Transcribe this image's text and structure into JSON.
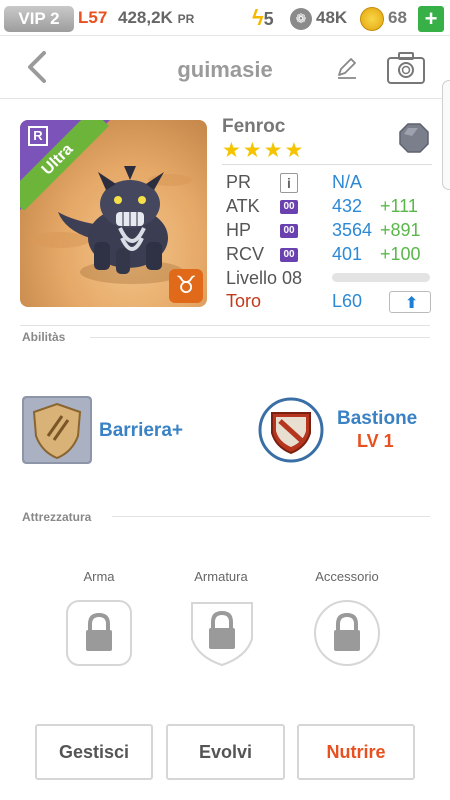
{
  "status_bar": {
    "vip": "VIP 2",
    "level": "L57",
    "pr_value": "428,2K",
    "pr_unit": "PR",
    "energy": "5",
    "paw": "48K",
    "coins": "68",
    "add": "+"
  },
  "header": {
    "title": "guimasie"
  },
  "monster": {
    "name": "Fenroc",
    "rarity": "Ultra",
    "badge": "R",
    "stars": "★★★★",
    "zodiac_symbol": "♉",
    "stats": {
      "pr": {
        "label": "PR",
        "info": "i",
        "value": "N/A"
      },
      "atk": {
        "label": "ATK",
        "badge": "00",
        "value": "432",
        "bonus": "+111"
      },
      "hp": {
        "label": "HP",
        "badge": "00",
        "value": "3564",
        "bonus": "+891"
      },
      "rcv": {
        "label": "RCV",
        "badge": "00",
        "value": "401",
        "bonus": "+100"
      }
    },
    "level_label": "Livello 08",
    "xp_progress": 0,
    "zodiac_name": "Toro",
    "level_cap": "L60"
  },
  "abilities": {
    "title": "Abilitàs",
    "skill1": {
      "name": "Barriera+"
    },
    "skill2": {
      "name": "Bastione",
      "level": "LV 1"
    }
  },
  "equipment": {
    "title": "Attrezzatura",
    "slots": [
      "Arma",
      "Armatura",
      "Accessorio"
    ]
  },
  "actions": {
    "manage": "Gestisci",
    "evolve": "Evolvi",
    "feed": "Nutrire"
  },
  "colors": {
    "accent_blue": "#2c89d6",
    "bonus_green": "#5ab84a",
    "warning_orange": "#e8501f",
    "ultra_green": "#6db43a",
    "rare_purple": "#7c53b8"
  }
}
